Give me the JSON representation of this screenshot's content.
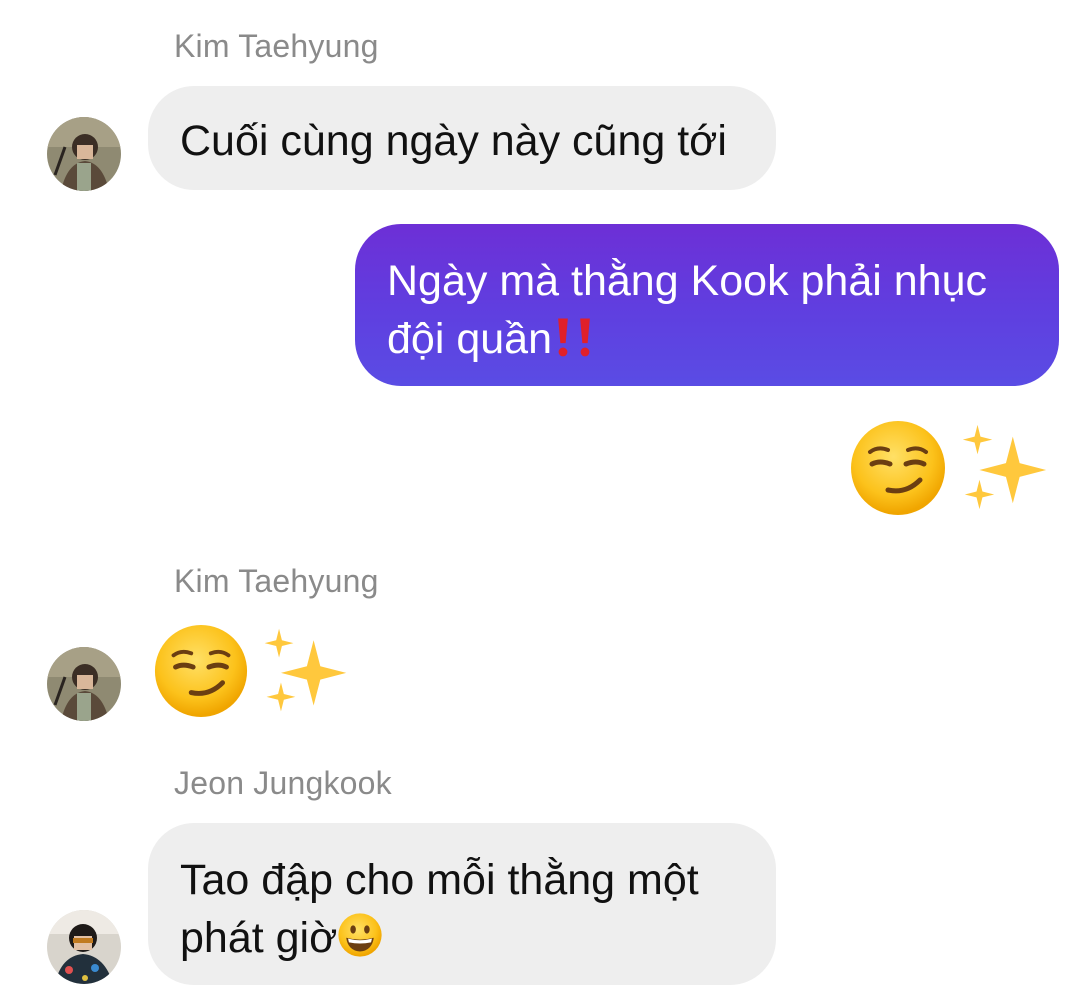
{
  "messages": [
    {
      "sender": "Kim Taehyung",
      "text": "Cuối cùng ngày này cũng tới",
      "avatar": "kim-taehyung-avatar"
    },
    {
      "sender": "",
      "line1": "Ngày mà thằng Kook phải nhục",
      "line2": "đội quần",
      "icon": "double-exclamation-icon",
      "direction": "outgoing"
    },
    {
      "sender": "",
      "emojis": [
        "smirking-face-icon",
        "sparkles-icon"
      ],
      "direction": "outgoing"
    },
    {
      "sender": "Kim Taehyung",
      "emojis": [
        "smirking-face-icon",
        "sparkles-icon"
      ],
      "avatar": "kim-taehyung-avatar"
    },
    {
      "sender": "Jeon Jungkook",
      "line1": "Tao đập cho mỗi thằng một",
      "line2": "phát giờ",
      "icon": "grinning-face-icon",
      "avatar": "jeon-jungkook-avatar"
    }
  ],
  "colors": {
    "incoming_bubble": "#eeeeee",
    "outgoing_bubble_start": "#6d2fd6",
    "outgoing_bubble_end": "#5a4ce4",
    "sender_name": "#8a8a8a"
  }
}
